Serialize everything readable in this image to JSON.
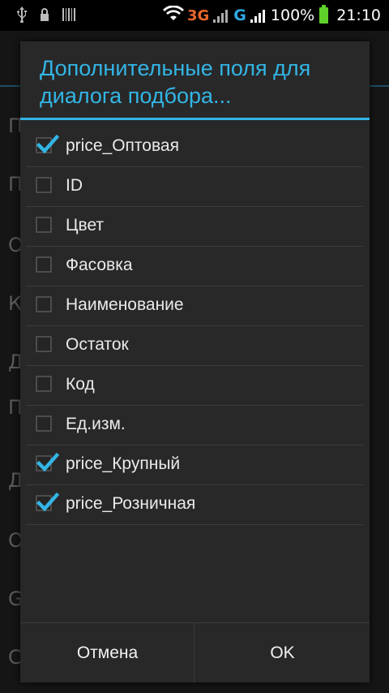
{
  "status_bar": {
    "network_3g": "3G",
    "network_g": "G",
    "battery_percent": "100%",
    "time": "21:10",
    "icons": [
      "usb-icon",
      "lock-icon",
      "barcode-icon",
      "wifi-icon",
      "signal-icon",
      "battery-icon"
    ],
    "battery_color": "#5fd12a"
  },
  "background": {
    "row_letters": [
      "П",
      "П",
      "О",
      "К",
      "Д",
      "П",
      "Д",
      "О",
      "G",
      "С"
    ]
  },
  "dialog": {
    "title": "Дополнительные поля для диалога подбора...",
    "accent_color": "#33b5e5",
    "items": [
      {
        "label": "price_Оптовая",
        "checked": true
      },
      {
        "label": "ID",
        "checked": false
      },
      {
        "label": "Цвет",
        "checked": false
      },
      {
        "label": "Фасовка",
        "checked": false
      },
      {
        "label": "Наименование",
        "checked": false
      },
      {
        "label": "Остаток",
        "checked": false
      },
      {
        "label": "Код",
        "checked": false
      },
      {
        "label": "Ед.изм.",
        "checked": false
      },
      {
        "label": "price_Крупный",
        "checked": true
      },
      {
        "label": "price_Розничная",
        "checked": true
      }
    ],
    "buttons": {
      "cancel": "Отмена",
      "ok": "OK"
    }
  }
}
